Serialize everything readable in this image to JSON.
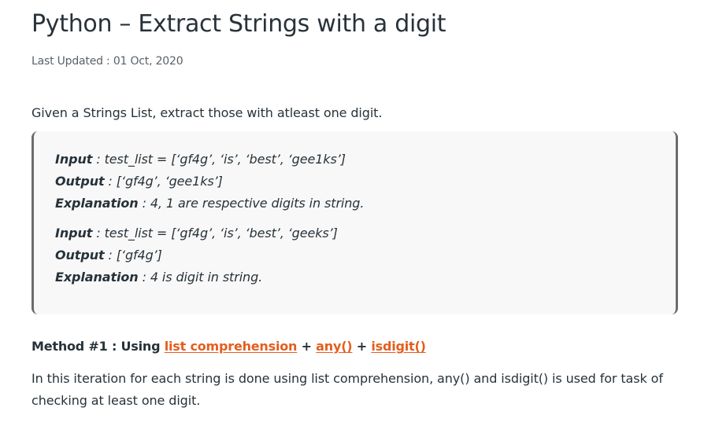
{
  "article": {
    "title": "Python – Extract Strings with a digit",
    "last_updated": "Last Updated : 01 Oct, 2020",
    "intro": "Given a Strings List, extract those with atleast one digit."
  },
  "examples": [
    {
      "input_label": "Input",
      "input_value": " : test_list = [‘gf4g’, ‘is’, ‘best’, ‘gee1ks’]",
      "output_label": "Output",
      "output_value": " : [‘gf4g’, ‘gee1ks’]",
      "explanation_label": "Explanation",
      "explanation_value": " : 4, 1 are respective digits in string."
    },
    {
      "input_label": "Input",
      "input_value": " : test_list = [‘gf4g’, ‘is’, ‘best’, ‘geeks’]",
      "output_label": "Output",
      "output_value": " : [‘gf4g’]",
      "explanation_label": "Explanation",
      "explanation_value": " : 4 is digit in string."
    }
  ],
  "method": {
    "prefix": "Method #1 : Using ",
    "link1": "list comprehension",
    "sep1": " + ",
    "link2": "any()",
    "sep2": " + ",
    "link3": "isdigit()",
    "description": "In this iteration for each string is done using list comprehension, any() and isdigit() is used for task of checking at least one digit."
  },
  "colors": {
    "text": "#273239",
    "link": "#e35e1e",
    "box_background": "#f8f8f8",
    "box_border": "#6c6c6c"
  }
}
